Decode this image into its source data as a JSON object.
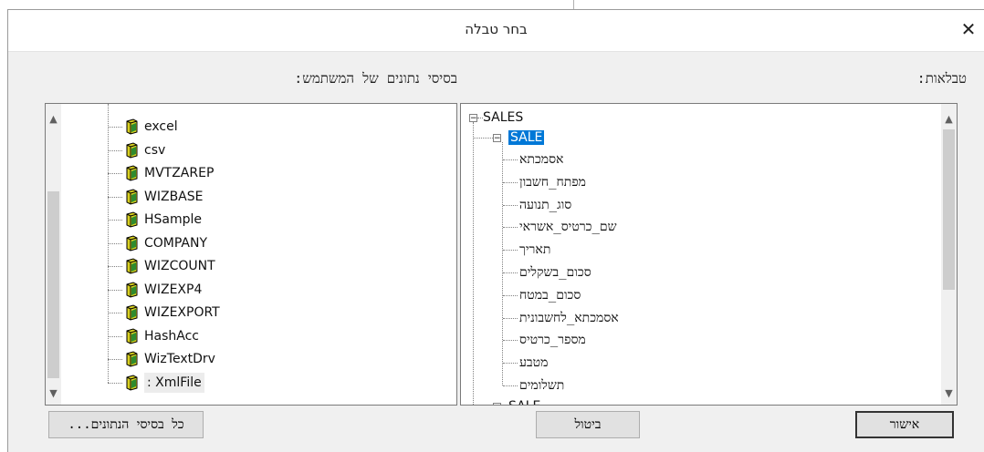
{
  "dialog": {
    "title": "בחר טבלה",
    "close_glyph": "✕"
  },
  "labels": {
    "user_databases": "בסיסי נתונים של המשתמש:",
    "tables": "טבלאות:"
  },
  "databases": [
    {
      "name": "excel"
    },
    {
      "name": "csv"
    },
    {
      "name": "MVTZAREP"
    },
    {
      "name": "WIZBASE"
    },
    {
      "name": "HSample"
    },
    {
      "name": "COMPANY"
    },
    {
      "name": "WIZCOUNT"
    },
    {
      "name": "WIZEXP4"
    },
    {
      "name": "WIZEXPORT"
    },
    {
      "name": "HashAcc"
    },
    {
      "name": "WizTextDrv"
    },
    {
      "name": ": XmlFile"
    }
  ],
  "tables_tree": {
    "root": "SALES",
    "root_expander": "−",
    "table": "SALE",
    "table_expander": "−",
    "fields": [
      "אסמכתא",
      "מפתח_חשבון",
      "סוג_תנועה",
      "שם_כרטיס_אשראי",
      "תאריך",
      "סכום_בשקלים",
      "סכום_במטח",
      "אסמכתא_לחשבונית",
      "מספר_כרטיס",
      "מטבע",
      "תשלומים"
    ],
    "next_item": "SALE"
  },
  "scrollbars": {
    "up_glyph": "▲",
    "down_glyph": "▼"
  },
  "buttons": {
    "all_databases": "כל בסיסי הנתונים...",
    "cancel": "ביטול",
    "ok": "אישור"
  },
  "colors": {
    "selection": "#0078d7",
    "window_bg": "#f0f0f0"
  },
  "icons": {
    "database": "database-icon"
  }
}
